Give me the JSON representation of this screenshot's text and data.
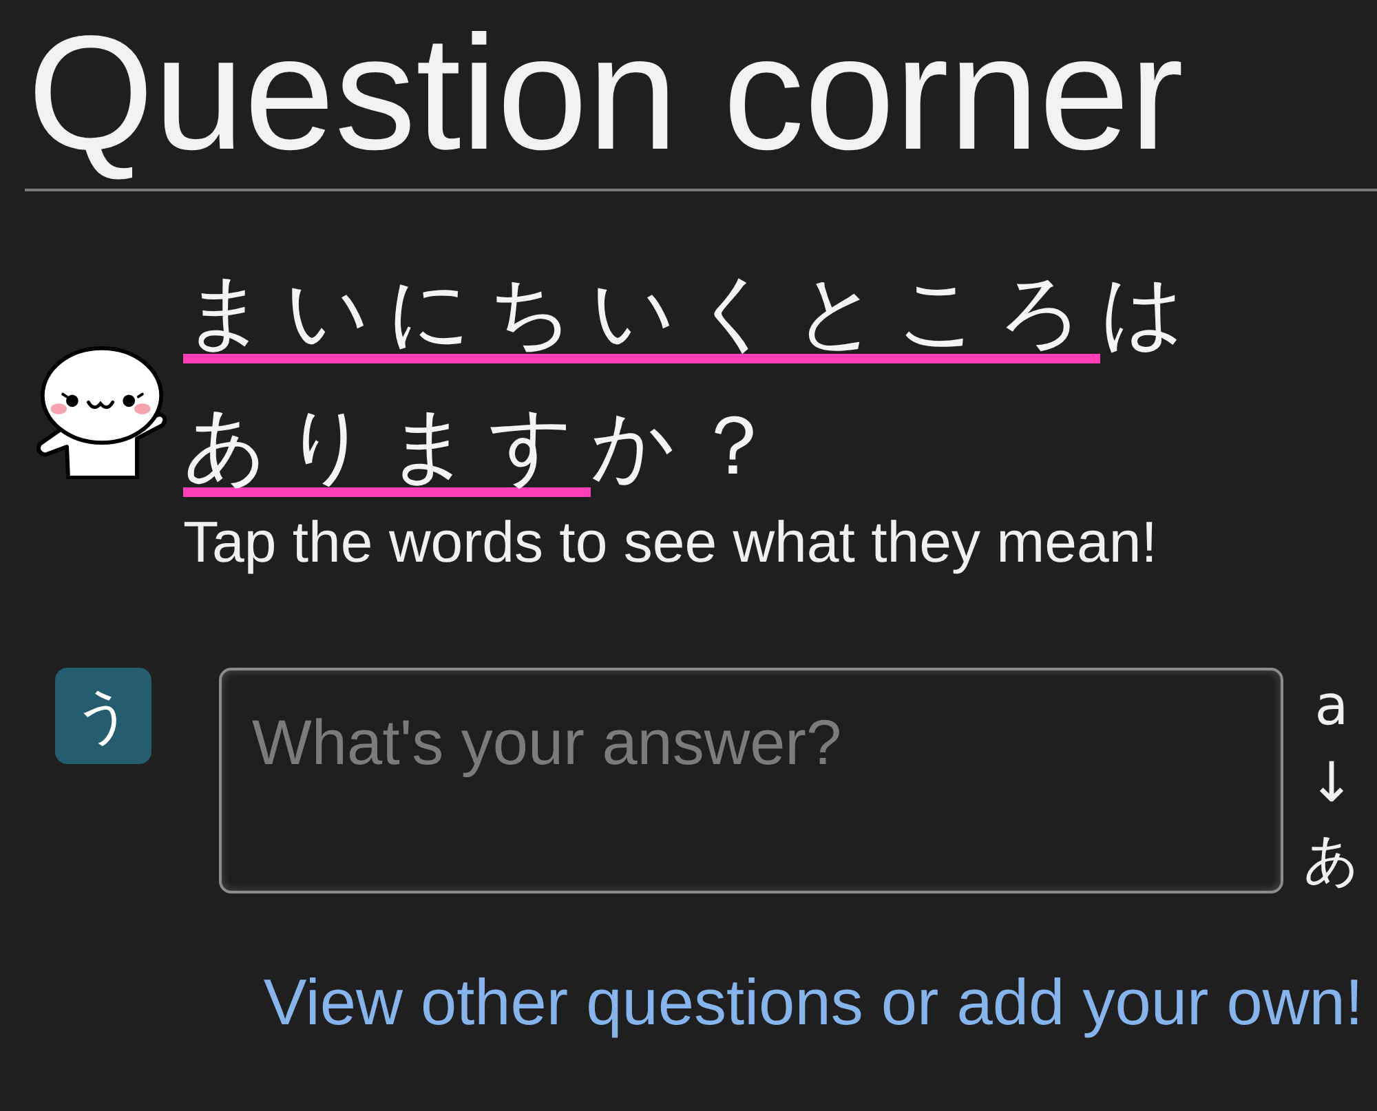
{
  "page": {
    "title": "Question corner"
  },
  "question": {
    "segments": [
      {
        "text": "まいにちいくところ",
        "kind": "word"
      },
      {
        "text": "は",
        "kind": "plain"
      },
      {
        "text": "あります",
        "kind": "word"
      },
      {
        "text": "か？",
        "kind": "plain"
      }
    ],
    "hint": "Tap the words to see what they mean!"
  },
  "answer": {
    "mode_button": "う",
    "placeholder": "What's your answer?",
    "conversion": {
      "from": "a",
      "arrow": "↓",
      "to": "あ"
    }
  },
  "footer_link": "View other questions or add your own!"
}
